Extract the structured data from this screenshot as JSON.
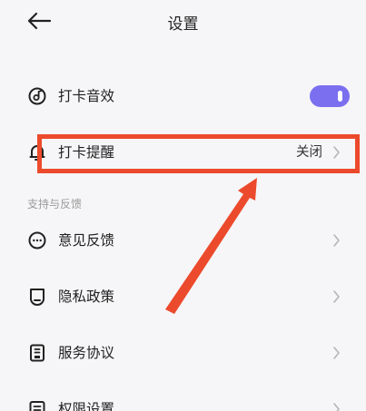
{
  "header": {
    "title": "设置"
  },
  "settings": {
    "sound": {
      "label": "打卡音效",
      "enabled": true
    },
    "reminder": {
      "label": "打卡提醒",
      "value": "关闭"
    }
  },
  "support": {
    "section_title": "支持与反馈",
    "items": [
      {
        "label": "意见反馈"
      },
      {
        "label": "隐私政策"
      },
      {
        "label": "服务协议"
      },
      {
        "label": "权限设置"
      }
    ]
  },
  "colors": {
    "accent": "#7b6ff0",
    "annotation": "#ec4a2c",
    "background": "#f6f6f8"
  }
}
